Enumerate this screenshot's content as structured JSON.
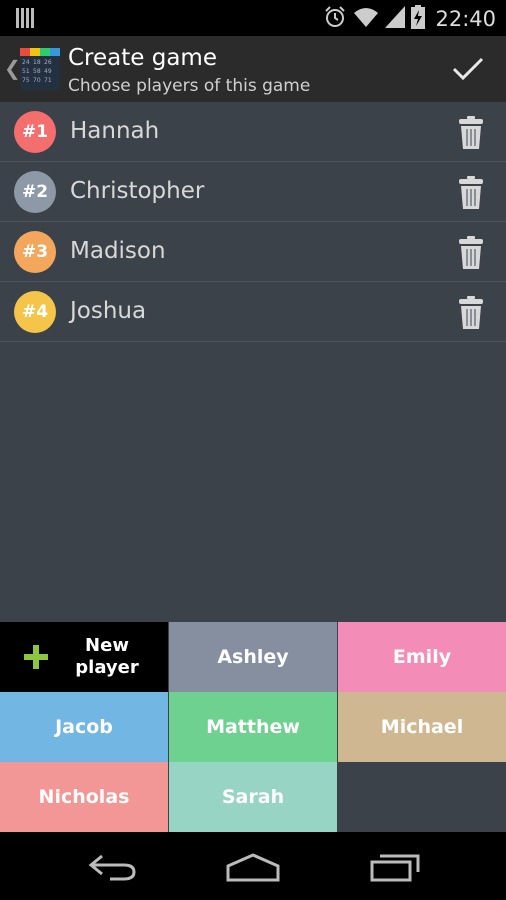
{
  "status": {
    "time": "22:40"
  },
  "header": {
    "title": "Create game",
    "subtitle": "Choose players of this game",
    "back_icon": "chevron-left-icon",
    "confirm_icon": "check-icon"
  },
  "players": [
    {
      "rank": "#1",
      "name": "Hannah",
      "color": "#f46e6e"
    },
    {
      "rank": "#2",
      "name": "Christopher",
      "color": "#8e99a8"
    },
    {
      "rank": "#3",
      "name": "Madison",
      "color": "#f2a75d"
    },
    {
      "rank": "#4",
      "name": "Joshua",
      "color": "#f5c54a"
    }
  ],
  "new_player": {
    "label_line1": "New",
    "label_line2": "player",
    "plus_color": "#8cc63f"
  },
  "available_players": [
    {
      "name": "Ashley",
      "color": "#858fa0"
    },
    {
      "name": "Emily",
      "color": "#f48cb8"
    },
    {
      "name": "Jacob",
      "color": "#72b6e4"
    },
    {
      "name": "Matthew",
      "color": "#6ed190"
    },
    {
      "name": "Michael",
      "color": "#cfb891"
    },
    {
      "name": "Nicholas",
      "color": "#f29696"
    },
    {
      "name": "Sarah",
      "color": "#98d4c4"
    }
  ]
}
